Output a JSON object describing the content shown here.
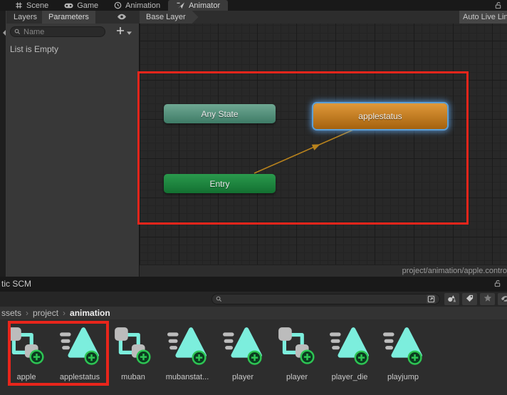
{
  "annotation_color": "#e8251b",
  "animator": {
    "tabs": [
      {
        "label": "Scene",
        "icon": "grid-icon",
        "active": false
      },
      {
        "label": "Game",
        "icon": "gamepad-icon",
        "active": false
      },
      {
        "label": "Animation",
        "icon": "clock-icon",
        "active": false
      },
      {
        "label": "Animator",
        "icon": "animator-icon",
        "active": true
      }
    ],
    "toolbar": {
      "layers_tab": "Layers",
      "parameters_tab": "Parameters",
      "breadcrumb": "Base Layer",
      "auto_live_link_label": "Auto Live Lin"
    },
    "parameters_panel": {
      "search_placeholder": "Name",
      "empty_text": "List is Empty"
    },
    "graph": {
      "nodes": [
        {
          "id": "any-state",
          "label": "Any State",
          "color_top": "#6fa893",
          "color_bottom": "#3e7b66",
          "selected": false
        },
        {
          "id": "applestatus",
          "label": "applestatus",
          "color_top": "#e0993a",
          "color_bottom": "#a5620e",
          "selected": true
        },
        {
          "id": "entry",
          "label": "Entry",
          "color_top": "#2a9a4d",
          "color_bottom": "#137031",
          "selected": false
        }
      ],
      "transition": {
        "from": "entry",
        "to": "applestatus",
        "color": "#b9831d"
      },
      "selection_glow": "#5d9fd4",
      "status_path": "project/animation/apple.contro"
    }
  },
  "project": {
    "tab_label": "tic SCM",
    "search_value": "",
    "search_trailing_icon": "open-window-icon",
    "toolbar_icons": [
      "shapes-icon",
      "tag-icon",
      "star-icon",
      "eye-slash-icon"
    ],
    "breadcrumb": [
      {
        "label": "ssets",
        "current": false
      },
      {
        "label": "project",
        "current": false
      },
      {
        "label": "animation",
        "current": true
      }
    ],
    "assets": [
      {
        "name": "apple",
        "type": "animator-controller"
      },
      {
        "name": "applestatus",
        "type": "animation-clip"
      },
      {
        "name": "muban",
        "type": "animator-controller"
      },
      {
        "name": "mubanstat...",
        "type": "animation-clip"
      },
      {
        "name": "player",
        "type": "animation-clip"
      },
      {
        "name": "player",
        "type": "animator-controller"
      },
      {
        "name": "player_die",
        "type": "animation-clip"
      },
      {
        "name": "playjump",
        "type": "animation-clip"
      }
    ],
    "asset_colors": {
      "mint": "#7ceedd",
      "gray": "#bcbcbc",
      "badge_green": "#2dc553",
      "badge_fill": "#0b3b20"
    }
  }
}
